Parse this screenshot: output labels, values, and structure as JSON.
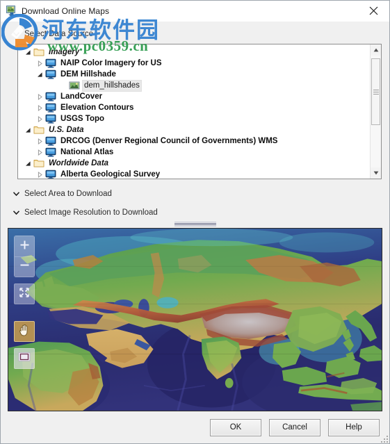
{
  "window": {
    "title": "Download Online Maps",
    "icon": "download-maps-icon",
    "close_label": "×"
  },
  "sections": {
    "data_source": {
      "label": "Select Data Source",
      "chevron": "chevron-down-icon",
      "expanded": true
    },
    "area": {
      "label": "Select Area to Download",
      "chevron": "chevron-down-icon",
      "expanded": false
    },
    "resolution": {
      "label": "Select Image Resolution to Download",
      "chevron": "chevron-down-icon",
      "expanded": false
    }
  },
  "tree": {
    "rows": [
      {
        "label": "Imagery",
        "level": 0,
        "kind": "group",
        "icon": "folder-icon",
        "twisty": "expanded",
        "selected": false
      },
      {
        "label": "NAIP Color Imagery for US",
        "level": 1,
        "kind": "node",
        "icon": "server-monitor-icon",
        "twisty": "collapsed",
        "selected": false
      },
      {
        "label": "DEM Hillshade",
        "level": 1,
        "kind": "node",
        "icon": "server-monitor-icon",
        "twisty": "expanded",
        "selected": false
      },
      {
        "label": "dem_hillshades",
        "level": 2,
        "kind": "leaf",
        "icon": "raster-layer-icon",
        "twisty": "none",
        "selected": true
      },
      {
        "label": "LandCover",
        "level": 1,
        "kind": "node",
        "icon": "server-monitor-icon",
        "twisty": "collapsed",
        "selected": false
      },
      {
        "label": "Elevation Contours",
        "level": 1,
        "kind": "node",
        "icon": "server-monitor-icon",
        "twisty": "collapsed",
        "selected": false
      },
      {
        "label": "USGS Topo",
        "level": 1,
        "kind": "node",
        "icon": "server-monitor-icon",
        "twisty": "collapsed",
        "selected": false
      },
      {
        "label": "U.S. Data",
        "level": 0,
        "kind": "group",
        "icon": "folder-icon",
        "twisty": "expanded",
        "selected": false
      },
      {
        "label": "DRCOG (Denver Regional Council of Governments) WMS",
        "level": 1,
        "kind": "node",
        "icon": "server-monitor-icon",
        "twisty": "collapsed",
        "selected": false
      },
      {
        "label": "National Atlas",
        "level": 1,
        "kind": "node",
        "icon": "server-monitor-icon",
        "twisty": "collapsed",
        "selected": false
      },
      {
        "label": "Worldwide Data",
        "level": 0,
        "kind": "group",
        "icon": "folder-icon",
        "twisty": "expanded",
        "selected": false
      },
      {
        "label": "Alberta Geological Survey",
        "level": 1,
        "kind": "node",
        "icon": "server-monitor-icon",
        "twisty": "collapsed",
        "selected": false
      }
    ],
    "scrollbar": {
      "up_icon": "scroll-up-arrow-icon",
      "down_icon": "scroll-down-arrow-icon",
      "thumb": "scroll-thumb"
    }
  },
  "map": {
    "tools": [
      {
        "name": "zoom-in-button",
        "icon": "plus-icon",
        "active": false
      },
      {
        "name": "zoom-out-button",
        "icon": "minus-icon",
        "active": false
      },
      {
        "name": "zoom-to-extent-button",
        "icon": "expand-arrows-icon",
        "active": false
      },
      {
        "name": "pan-button",
        "icon": "hand-icon",
        "active": true
      },
      {
        "name": "select-area-button",
        "icon": "rectangle-select-icon",
        "active": false
      }
    ]
  },
  "footer": {
    "ok": "OK",
    "cancel": "Cancel",
    "help": "Help"
  },
  "watermark": {
    "chinese": "河东软件园",
    "url": "www.pc0359.cn"
  },
  "colors": {
    "accent": "#2f7fd0",
    "watermark_green": "#2e9b4e",
    "tool_active": "#d6a84a",
    "dialog_bg": "#f0f0f0"
  }
}
